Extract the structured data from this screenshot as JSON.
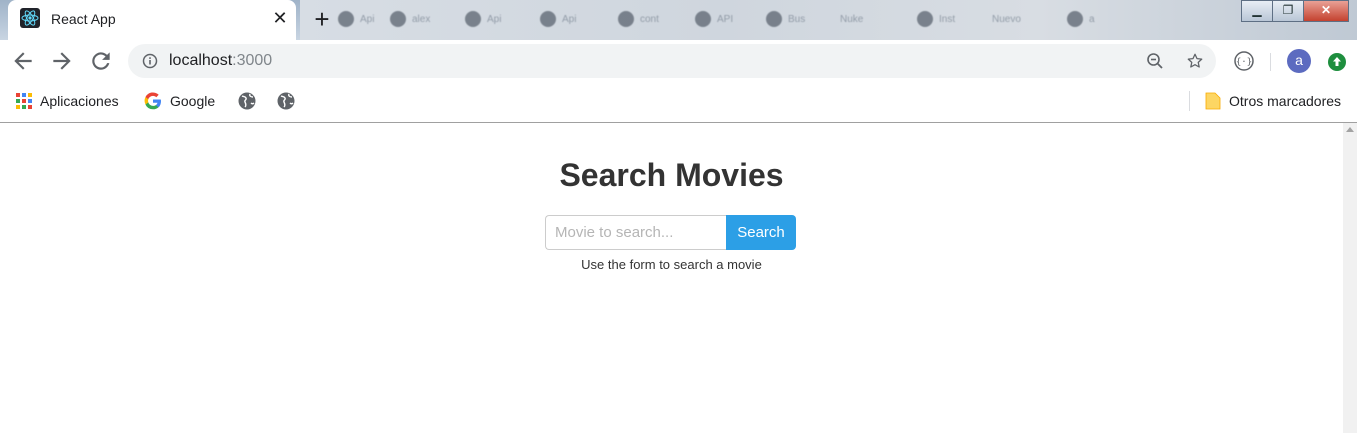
{
  "browser": {
    "active_tab": {
      "title": "React App",
      "favicon": "react-icon"
    },
    "background_tabs": [
      "Api",
      "alex",
      "Api",
      "Api",
      "cont",
      "API",
      "Bus",
      "Nuke",
      "Inst",
      "Nuevo",
      "a"
    ],
    "new_tab_symbol": "+",
    "close_symbol": "✕",
    "address": {
      "host": "localhost",
      "port": ":3000"
    },
    "avatar_letter": "a",
    "bookmarks": [
      {
        "label": "Aplicaciones",
        "icon": "apps-grid-icon"
      },
      {
        "label": "Google",
        "icon": "google-icon"
      },
      {
        "label": "",
        "icon": "globe-icon"
      },
      {
        "label": "",
        "icon": "globe-icon"
      }
    ],
    "other_bookmarks": "Otros marcadores",
    "window_controls": [
      "minimize",
      "maximize",
      "close"
    ]
  },
  "app": {
    "title": "Search Movies",
    "search": {
      "placeholder": "Movie to search...",
      "value": "",
      "button_label": "Search"
    },
    "help_text": "Use the form to search a movie"
  },
  "colors": {
    "primary_button": "#2c9fe6",
    "title_text": "#333333",
    "avatar": "#5c6bc0"
  }
}
